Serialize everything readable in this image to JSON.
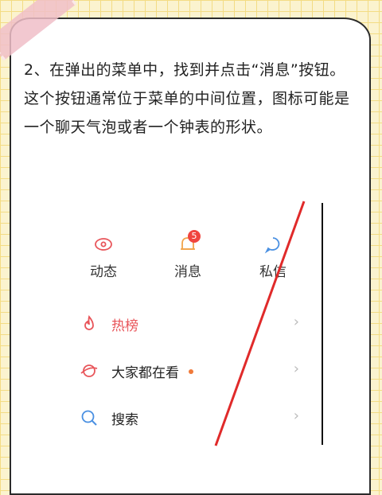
{
  "instruction": "2、在弹出的菜单中，找到并点击“消息”按钮。这个按钮通常位于菜单的中间位置，图标可能是一个聊天气泡或者一个钟表的形状。",
  "tabs": [
    {
      "label": "动态",
      "icon": "eye-icon"
    },
    {
      "label": "消息",
      "icon": "bell-icon",
      "badge": "5"
    },
    {
      "label": "私信",
      "icon": "chat-bubble-icon"
    }
  ],
  "menu": [
    {
      "label": "热榜",
      "icon": "flame-icon",
      "color": "#e8555a"
    },
    {
      "label": "大家都在看",
      "icon": "planet-icon",
      "color": "#222222",
      "dot_color": "#f07a3a"
    },
    {
      "label": "搜索",
      "icon": "search-icon",
      "color": "#222222"
    }
  ],
  "colors": {
    "red": "#f0453f",
    "blue": "#4a90e2",
    "pink": "#e8555a",
    "slash": "#e02a2a"
  }
}
